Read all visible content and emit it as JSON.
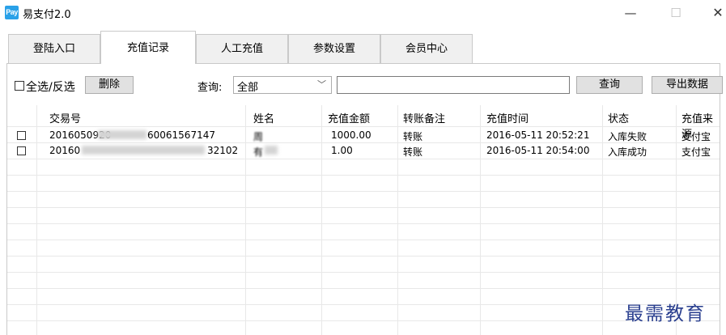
{
  "window": {
    "icon_text": "Pay",
    "title": "易支付2.0",
    "minimize_glyph": "—",
    "maximize_glyph": "☐",
    "close_glyph": "✕"
  },
  "tabs": [
    {
      "label": "登陆入口",
      "active": false
    },
    {
      "label": "充值记录",
      "active": true
    },
    {
      "label": "人工充值",
      "active": false
    },
    {
      "label": "参数设置",
      "active": false
    },
    {
      "label": "会员中心",
      "active": false
    }
  ],
  "toolbar": {
    "select_all_label": "全选/反选",
    "delete_label": "删除",
    "query_label": "查询:",
    "filter_value": "全部",
    "filter_arrow": "﹀",
    "search_value": "",
    "query_button": "查询",
    "export_button": "导出数据"
  },
  "table": {
    "columns": [
      "交易号",
      "姓名",
      "充值金额",
      "转账备注",
      "充值时间",
      "状态",
      "充值来源"
    ],
    "rows": [
      {
        "checked": false,
        "txn_prefix": "20160509​20",
        "txn_suffix": "60061567147",
        "name": "周",
        "amount": "1000.00",
        "note": "转账",
        "time": "2016-05-11 20:52:21",
        "status": "入库失败",
        "source": "支付宝"
      },
      {
        "checked": false,
        "txn_prefix": "20160",
        "txn_suffix": "32102",
        "name": "有",
        "amount": "1.00",
        "note": "转账",
        "time": "2016-05-11 20:54:00",
        "status": "入库成功",
        "source": "支付宝"
      }
    ]
  },
  "watermark": "最需教育",
  "colors": {
    "icon_blue": "#2aa1e8",
    "watermark": "#2a3f8f"
  }
}
